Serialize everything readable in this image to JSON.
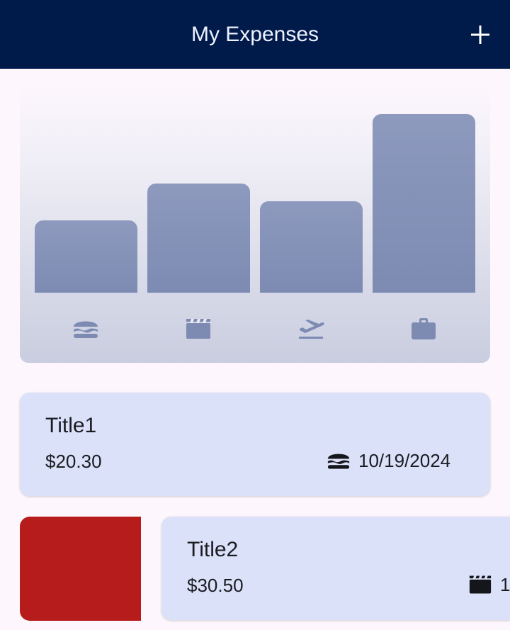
{
  "app_bar": {
    "title": "My Expenses",
    "add_icon": "plus-icon",
    "background_color": "#001a4a"
  },
  "chart": {
    "category_icons": [
      "burger-icon",
      "clapperboard-icon",
      "flight-takeoff-icon",
      "briefcase-icon"
    ],
    "bar_color": "#8592b8"
  },
  "chart_data": {
    "type": "bar",
    "categories": [
      "food",
      "leisure",
      "travel",
      "work"
    ],
    "values": [
      20.3,
      30.5,
      25.5,
      50.0
    ],
    "ylim": [
      0,
      50
    ],
    "grid": false
  },
  "expenses": [
    {
      "title": "Title1",
      "amount": "$20.30",
      "category_icon": "burger-icon",
      "date": "10/19/2024"
    },
    {
      "title": "Title2",
      "amount": "$30.50",
      "category_icon": "clapperboard-icon",
      "date": "1"
    }
  ],
  "swipe_delete_color": "#b71c1c"
}
